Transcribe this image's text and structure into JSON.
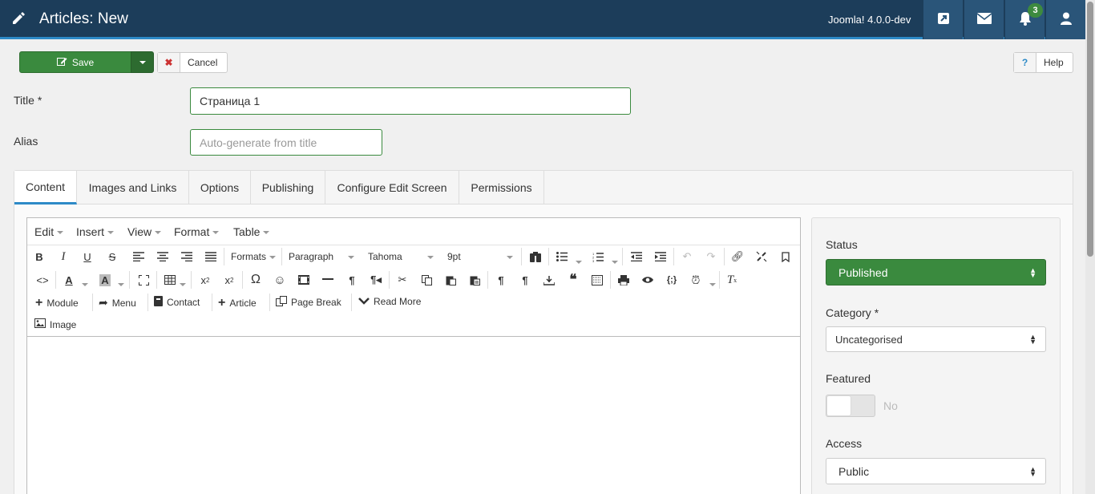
{
  "header": {
    "title": "Articles: New",
    "version": "Joomla! 4.0.0-dev",
    "notifications_count": "3",
    "icons": [
      "external-link-icon",
      "envelope-icon",
      "bell-icon",
      "user-icon"
    ]
  },
  "toolbar": {
    "save_label": "Save",
    "cancel_label": "Cancel",
    "help_label": "Help",
    "help_glyph": "?",
    "cancel_glyph": "✖"
  },
  "form": {
    "title_label": "Title *",
    "title_value": "Страница 1",
    "alias_label": "Alias",
    "alias_placeholder": "Auto-generate from title"
  },
  "tabs": [
    "Content",
    "Images and Links",
    "Options",
    "Publishing",
    "Configure Edit Screen",
    "Permissions"
  ],
  "editor": {
    "menus": [
      "Edit",
      "Insert",
      "View",
      "Format",
      "Table"
    ],
    "formats_label": "Formats",
    "block_label": "Paragraph",
    "font_label": "Tahoma",
    "size_label": "9pt",
    "buttons": [
      "Module",
      "Menu",
      "Contact",
      "Article",
      "Page Break",
      "Read More",
      "Image"
    ]
  },
  "sidebar": {
    "status_label": "Status",
    "status_value": "Published",
    "category_label": "Category *",
    "category_value": "Uncategorised",
    "featured_label": "Featured",
    "featured_value": "No",
    "access_label": "Access",
    "access_value": "Public"
  },
  "colors": {
    "header_bg": "#1c3d5a",
    "accent": "#2d8ac7",
    "success": "#3a8a3e"
  }
}
